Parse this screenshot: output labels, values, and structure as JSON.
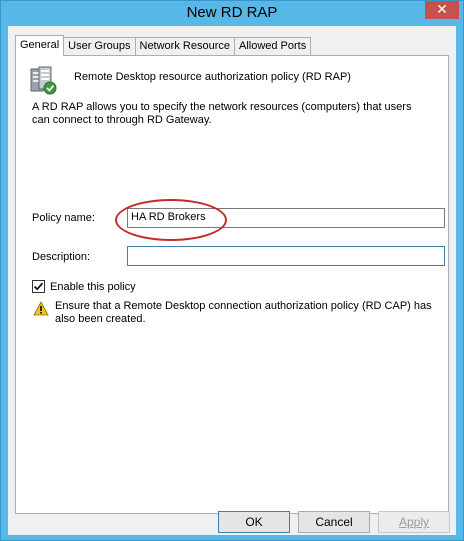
{
  "window": {
    "title": "New RD RAP",
    "close_glyph": "✕"
  },
  "tabs": [
    {
      "label": "General",
      "active": true
    },
    {
      "label": "User Groups",
      "active": false
    },
    {
      "label": "Network Resource",
      "active": false
    },
    {
      "label": "Allowed Ports",
      "active": false
    }
  ],
  "general": {
    "header": "Remote Desktop resource authorization policy (RD RAP)",
    "description": "A RD RAP allows you to specify the network resources (computers) that users can connect to through RD Gateway.",
    "policy_name_label": "Policy name:",
    "policy_name_value": "HA RD Brokers",
    "description_label": "Description:",
    "description_value": "",
    "enable_label": "Enable this policy",
    "enable_checked": true,
    "warning": "Ensure that a Remote Desktop connection authorization policy (RD CAP) has also been created."
  },
  "buttons": {
    "ok": "OK",
    "cancel": "Cancel",
    "apply": "Apply"
  },
  "colors": {
    "titlebar": "#57b8e8",
    "highlight": "#c62a2a",
    "close": "#c75050"
  }
}
